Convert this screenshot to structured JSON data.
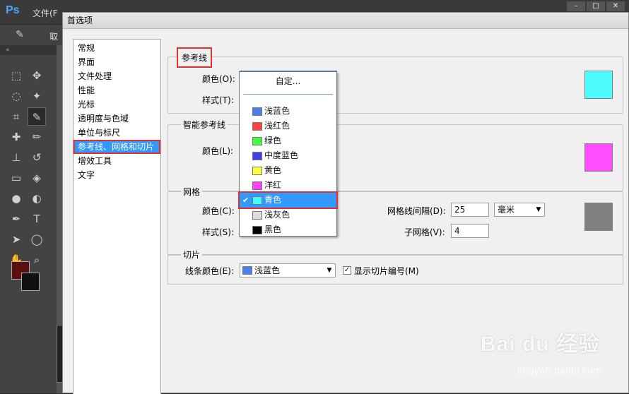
{
  "app": {
    "logo": "Ps",
    "menu_file": "文件(F",
    "win_buttons": [
      "–",
      "□",
      "✕"
    ],
    "options_label": "取"
  },
  "tools": [
    "marquee-icon",
    "move-icon",
    "lasso-icon",
    "magic-wand-icon",
    "crop-icon",
    "eyedropper-icon",
    "healing-brush-icon",
    "brush-icon",
    "clone-stamp-icon",
    "history-brush-icon",
    "eraser-icon",
    "paint-bucket-icon",
    "blur-icon",
    "dodge-icon",
    "pen-icon",
    "type-icon",
    "path-select-icon",
    "ellipse-icon",
    "hand-icon",
    "zoom-icon"
  ],
  "colors": {
    "foreground": "#5b0f0f",
    "background": "#111111"
  },
  "dialog": {
    "title": "首选项",
    "nav": [
      "常规",
      "界面",
      "文件处理",
      "性能",
      "光标",
      "透明度与色域",
      "单位与标尺",
      "参考线、网格和切片",
      "增效工具",
      "文字"
    ],
    "selected_nav": "参考线、网格和切片",
    "guides": {
      "legend": "参考线",
      "color_label": "颜色(O):",
      "color_value": "青色",
      "color_hex": "#4dfcff",
      "style_label": "样式(T):"
    },
    "smart_guides": {
      "legend": "智能参考线",
      "color_label": "颜色(L):",
      "color_hex": "#ff4dff"
    },
    "grid": {
      "legend": "网格",
      "color_label": "颜色(C):",
      "style_label": "样式(S):",
      "gridline_label": "网格线间隔(D):",
      "gridline_value": "25",
      "unit_value": "毫米",
      "subdiv_label": "子网格(V):",
      "subdiv_value": "4",
      "color_hex": "#808080"
    },
    "slices": {
      "legend": "切片",
      "line_color_label": "线条颜色(E):",
      "line_color_value": "浅蓝色",
      "line_color_hex": "#4d7ff0",
      "show_numbers_label": "显示切片编号(M)",
      "show_numbers_checked": true
    },
    "dropdown": {
      "custom": "自定...",
      "items": [
        {
          "label": "浅蓝色",
          "color": "#4d7ff0",
          "selected": false
        },
        {
          "label": "浅红色",
          "color": "#ff4040",
          "selected": false
        },
        {
          "label": "绿色",
          "color": "#40ff40",
          "selected": false
        },
        {
          "label": "中度蓝色",
          "color": "#4040e0",
          "selected": false
        },
        {
          "label": "黄色",
          "color": "#ffff40",
          "selected": false
        },
        {
          "label": "洋红",
          "color": "#ff40ff",
          "selected": false
        },
        {
          "label": "青色",
          "color": "#40ffff",
          "selected": true
        },
        {
          "label": "浅灰色",
          "color": "#dcdcdc",
          "selected": false
        },
        {
          "label": "黑色",
          "color": "#000000",
          "selected": false
        }
      ]
    }
  },
  "watermark": {
    "brand": "Bai du 经验",
    "url": "jingyan.baidu.com"
  }
}
